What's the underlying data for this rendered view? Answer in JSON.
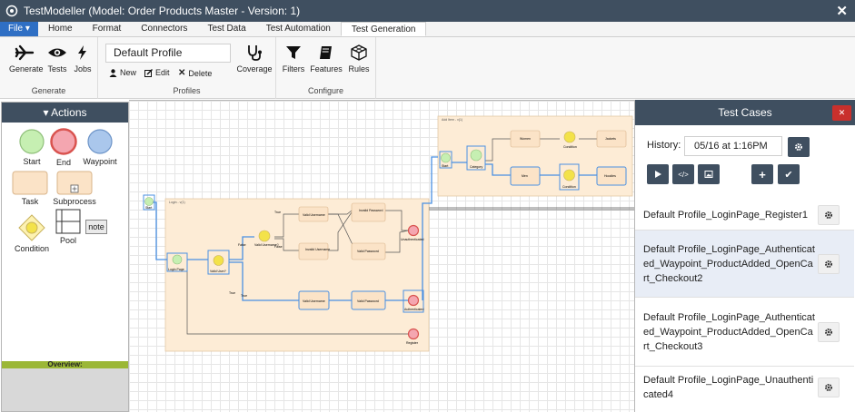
{
  "window": {
    "title": "TestModeller (Model: Order Products Master - Version: 1)"
  },
  "menu": {
    "tabs": [
      "File",
      "Home",
      "Format",
      "Connectors",
      "Test Data",
      "Test Automation",
      "Test Generation"
    ],
    "active": "Test Generation"
  },
  "ribbon": {
    "generate": {
      "label": "Generate",
      "buttons": [
        "Generate",
        "Tests",
        "Jobs"
      ]
    },
    "profiles": {
      "label": "Profiles",
      "current": "Default Profile",
      "new": "New",
      "edit": "Edit",
      "delete": "Delete",
      "coverage": "Coverage"
    },
    "configure": {
      "label": "Configure",
      "buttons": [
        "Filters",
        "Features",
        "Rules"
      ]
    }
  },
  "actions": {
    "title": "Actions",
    "shapes": [
      "Start",
      "End",
      "Waypoint",
      "Task",
      "Subprocess",
      "Condition",
      "Pool",
      "note"
    ],
    "overview": "Overview:"
  },
  "canvas": {
    "pools": [
      "Login - v(1)",
      "Add Item - v(1)"
    ],
    "nodes": [
      "Start",
      "Login Page",
      "Valid User?",
      "Valid Username?",
      "Valid Username",
      "Invalid Username",
      "Invalid Password",
      "Valid Password",
      "Unauthenticated",
      "Valid Username",
      "Valid Password",
      "Authenticated",
      "Register",
      "Start",
      "Category",
      "Women",
      "Condition",
      "Jackets",
      "Men",
      "Condition",
      "Hoodies"
    ],
    "edges": [
      "False",
      "True",
      "True",
      "False",
      "True"
    ]
  },
  "testcases": {
    "title": "Test Cases",
    "history_label": "History:",
    "history_value": "05/16 at 1:16PM",
    "items": [
      "Default Profile_LoginPage_Register1",
      "Default Profile_LoginPage_Authenticated_Waypoint_ProductAdded_OpenCart_Checkout2",
      "Default Profile_LoginPage_Authenticated_Waypoint_ProductAdded_OpenCart_Checkout3",
      "Default Profile_LoginPage_Unauthenticated4"
    ]
  },
  "colors": {
    "titlebar": "#3f4f60",
    "file_tab": "#2f6fc4",
    "close_button": "#c9302c",
    "overview_bar": "#9bb736"
  }
}
